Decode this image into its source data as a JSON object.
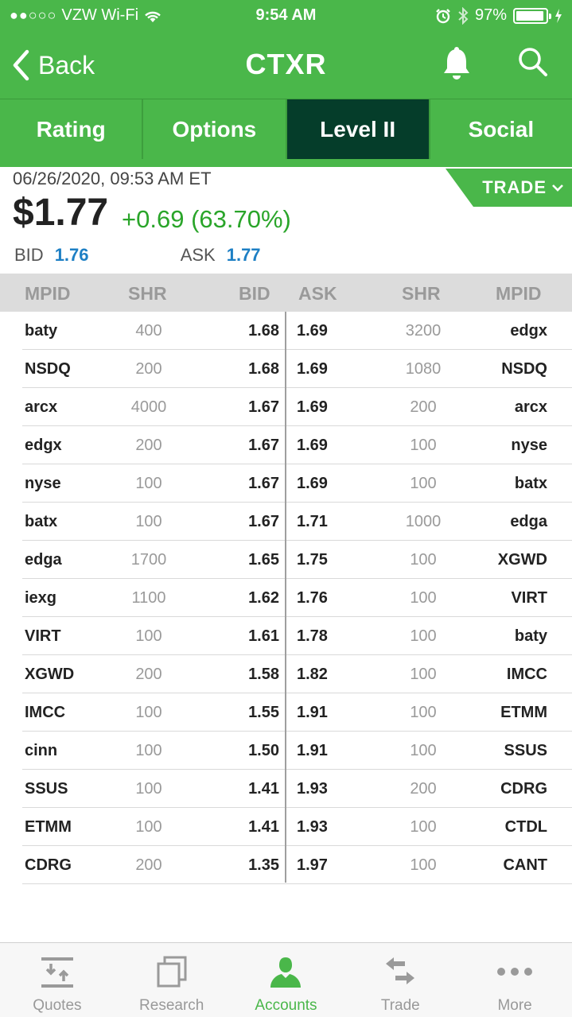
{
  "status_bar": {
    "signal": "●●○○○",
    "carrier": "VZW Wi-Fi",
    "time": "9:54 AM",
    "battery": "97%"
  },
  "nav": {
    "back_label": "Back",
    "title": "CTXR"
  },
  "tabs": [
    {
      "label": "Rating",
      "active": false
    },
    {
      "label": "Options",
      "active": false
    },
    {
      "label": "Level II",
      "active": true
    },
    {
      "label": "Social",
      "active": false
    }
  ],
  "quote": {
    "timestamp": "06/26/2020, 09:53 AM ET",
    "price": "$1.77",
    "change": "+0.69",
    "change_pct": "(63.70%)",
    "bid_label": "BID",
    "bid": "1.76",
    "ask_label": "ASK",
    "ask": "1.77",
    "trade_label": "TRADE"
  },
  "table": {
    "headers": [
      "MPID",
      "SHR",
      "BID",
      "ASK",
      "SHR",
      "MPID"
    ],
    "rows": [
      {
        "bid_mpid": "baty",
        "bid_shr": "400",
        "bid": "1.68",
        "ask": "1.69",
        "ask_shr": "3200",
        "ask_mpid": "edgx"
      },
      {
        "bid_mpid": "NSDQ",
        "bid_shr": "200",
        "bid": "1.68",
        "ask": "1.69",
        "ask_shr": "1080",
        "ask_mpid": "NSDQ"
      },
      {
        "bid_mpid": "arcx",
        "bid_shr": "4000",
        "bid": "1.67",
        "ask": "1.69",
        "ask_shr": "200",
        "ask_mpid": "arcx"
      },
      {
        "bid_mpid": "edgx",
        "bid_shr": "200",
        "bid": "1.67",
        "ask": "1.69",
        "ask_shr": "100",
        "ask_mpid": "nyse"
      },
      {
        "bid_mpid": "nyse",
        "bid_shr": "100",
        "bid": "1.67",
        "ask": "1.69",
        "ask_shr": "100",
        "ask_mpid": "batx"
      },
      {
        "bid_mpid": "batx",
        "bid_shr": "100",
        "bid": "1.67",
        "ask": "1.71",
        "ask_shr": "1000",
        "ask_mpid": "edga"
      },
      {
        "bid_mpid": "edga",
        "bid_shr": "1700",
        "bid": "1.65",
        "ask": "1.75",
        "ask_shr": "100",
        "ask_mpid": "XGWD"
      },
      {
        "bid_mpid": "iexg",
        "bid_shr": "1100",
        "bid": "1.62",
        "ask": "1.76",
        "ask_shr": "100",
        "ask_mpid": "VIRT"
      },
      {
        "bid_mpid": "VIRT",
        "bid_shr": "100",
        "bid": "1.61",
        "ask": "1.78",
        "ask_shr": "100",
        "ask_mpid": "baty"
      },
      {
        "bid_mpid": "XGWD",
        "bid_shr": "200",
        "bid": "1.58",
        "ask": "1.82",
        "ask_shr": "100",
        "ask_mpid": "IMCC"
      },
      {
        "bid_mpid": "IMCC",
        "bid_shr": "100",
        "bid": "1.55",
        "ask": "1.91",
        "ask_shr": "100",
        "ask_mpid": "ETMM"
      },
      {
        "bid_mpid": "cinn",
        "bid_shr": "100",
        "bid": "1.50",
        "ask": "1.91",
        "ask_shr": "100",
        "ask_mpid": "SSUS"
      },
      {
        "bid_mpid": "SSUS",
        "bid_shr": "100",
        "bid": "1.41",
        "ask": "1.93",
        "ask_shr": "200",
        "ask_mpid": "CDRG"
      },
      {
        "bid_mpid": "ETMM",
        "bid_shr": "100",
        "bid": "1.41",
        "ask": "1.93",
        "ask_shr": "100",
        "ask_mpid": "CTDL"
      },
      {
        "bid_mpid": "CDRG",
        "bid_shr": "200",
        "bid": "1.35",
        "ask": "1.97",
        "ask_shr": "100",
        "ask_mpid": "CANT"
      }
    ]
  },
  "bottom_tabs": [
    {
      "label": "Quotes",
      "icon": "quotes-icon",
      "active": false
    },
    {
      "label": "Research",
      "icon": "research-icon",
      "active": false
    },
    {
      "label": "Accounts",
      "icon": "accounts-icon",
      "active": true
    },
    {
      "label": "Trade",
      "icon": "trade-icon",
      "active": false
    },
    {
      "label": "More",
      "icon": "more-icon",
      "active": false
    }
  ],
  "colors": {
    "brand_green": "#4ab74a",
    "active_tab": "#053d2a",
    "positive": "#2aa52a",
    "link_blue": "#1d7fc4"
  }
}
